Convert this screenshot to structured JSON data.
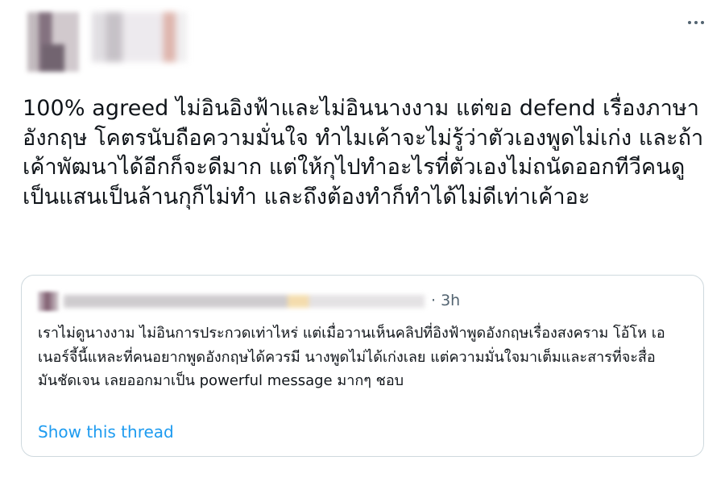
{
  "tweet": {
    "text": "100% agreed ไม่อินอิงฟ้าและไม่อินนางงาม แต่ขอ defend เรื่องภาษาอังกฤษ โคตรนับถือความมั่นใจ ทำไมเค้าจะไม่รู้ว่าตัวเองพูดไม่เก่ง และถ้าเค้าพัฒนาได้อีกก็จะดีมาก แต่ให้กุไปทำอะไรที่ตัวเองไม่ถนัดออกทีวีคนดูเป็นแสนเป็นล้านกุก็ไม่ทำ และถึงต้องทำก็ทำได้ไม่ดีเท่าเค้าอะ",
    "more_icon": "ellipsis-icon"
  },
  "quote": {
    "time": "· 3h",
    "text": "เราไม่ดูนางงาม ไม่อินการประกวดเท่าไหร่ แต่เมื่อวานเห็นคลิปที่อิงฟ้าพูดอังกฤษเรื่องสงคราม โอ้โห เอเนอร์จี้นี้แหละที่คนอยากพูดอังกฤษได้ควรมี นางพูดไม่ได้เก่งเลย แต่ความมั่นใจมาเต็มและสารที่จะสื่อมันชัดเจน เลยออกมาเป็น powerful message มากๆ ชอบ",
    "show_thread": "Show this thread"
  },
  "colors": {
    "text": "#0f1419",
    "secondary": "#536471",
    "link": "#1d9bf0",
    "border": "#cfd9de"
  }
}
